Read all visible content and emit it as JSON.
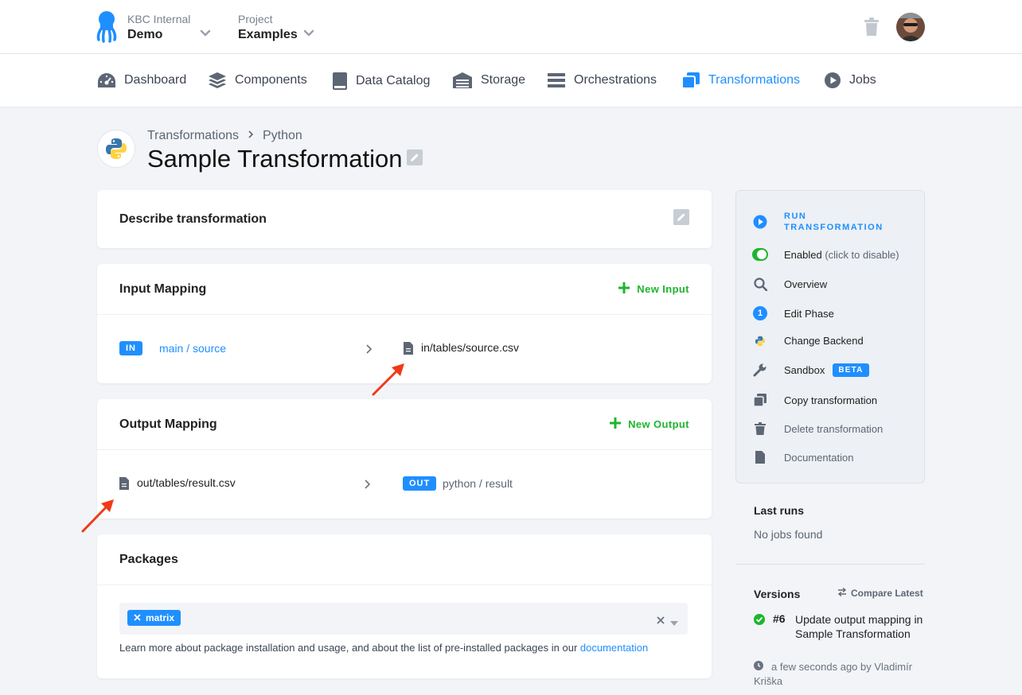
{
  "header": {
    "org_label": "KBC Internal",
    "org_name": "Demo",
    "project_label": "Project",
    "project_name": "Examples"
  },
  "nav": {
    "items": [
      {
        "label": "Dashboard",
        "icon": "dashboard-icon"
      },
      {
        "label": "Components",
        "icon": "layers-icon"
      },
      {
        "label": "Data Catalog",
        "icon": "book-icon"
      },
      {
        "label": "Storage",
        "icon": "warehouse-icon"
      },
      {
        "label": "Orchestrations",
        "icon": "bars-icon"
      },
      {
        "label": "Transformations",
        "icon": "copy-icon",
        "active": true
      },
      {
        "label": "Jobs",
        "icon": "play-circle-icon"
      }
    ]
  },
  "page": {
    "breadcrumb_root": "Transformations",
    "breadcrumb_current": "Python",
    "title": "Sample Transformation"
  },
  "describe": {
    "title": "Describe transformation"
  },
  "input_mapping": {
    "title": "Input Mapping",
    "new_label": "New Input",
    "badge": "IN",
    "source": "main / source",
    "destination": "in/tables/source.csv"
  },
  "output_mapping": {
    "title": "Output Mapping",
    "new_label": "New Output",
    "source": "out/tables/result.csv",
    "badge": "OUT",
    "destination": "python / result"
  },
  "packages": {
    "title": "Packages",
    "tags": [
      "matrix"
    ],
    "help_text": "Learn more about package installation and usage, and about the list of pre-installed packages in our",
    "help_link": "documentation"
  },
  "sidebar": {
    "run_line1": "RUN",
    "run_line2": "TRANSFORMATION",
    "enabled": "Enabled",
    "enabled_hint": "(click to disable)",
    "overview": "Overview",
    "edit_phase": "Edit Phase",
    "phase_number": "1",
    "change_backend": "Change Backend",
    "sandbox": "Sandbox",
    "beta": "BETA",
    "copy": "Copy transformation",
    "delete": "Delete transformation",
    "documentation": "Documentation"
  },
  "last_runs": {
    "title": "Last runs",
    "empty": "No jobs found"
  },
  "versions": {
    "title": "Versions",
    "compare": "Compare Latest",
    "items": [
      {
        "number": "#6",
        "description": "Update output mapping in Sample Transformation",
        "meta": "a few seconds ago by Vladimír Kriška"
      }
    ]
  },
  "colors": {
    "accent": "#1f8fff",
    "success": "#1db52e",
    "annotation_arrow": "#f03a17"
  }
}
